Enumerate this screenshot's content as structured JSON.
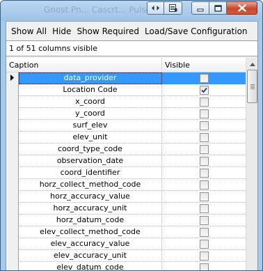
{
  "window": {
    "ghost_title": "Gnost Pn... Cascrt... Pulse"
  },
  "menubar": {
    "items": [
      "Show All",
      "Hide",
      "Show Required",
      "Load/Save Configuration"
    ]
  },
  "status": {
    "text": "1 of 51 columns visible"
  },
  "grid": {
    "headers": {
      "caption": "Caption",
      "visible": "Visible"
    },
    "rows": [
      {
        "caption": "data_provider",
        "visible": false,
        "selected": true,
        "current": true
      },
      {
        "caption": "Location Code",
        "visible": true
      },
      {
        "caption": "x_coord",
        "visible": false
      },
      {
        "caption": "y_coord",
        "visible": false
      },
      {
        "caption": "surf_elev",
        "visible": false
      },
      {
        "caption": "elev_unit",
        "visible": false
      },
      {
        "caption": "coord_type_code",
        "visible": false
      },
      {
        "caption": "observation_date",
        "visible": false
      },
      {
        "caption": "coord_identifier",
        "visible": false
      },
      {
        "caption": "horz_collect_method_code",
        "visible": false
      },
      {
        "caption": "horz_accuracy_value",
        "visible": false
      },
      {
        "caption": "horz_accuracy_unit",
        "visible": false
      },
      {
        "caption": "horz_datum_code",
        "visible": false
      },
      {
        "caption": "elev_collect_method_code",
        "visible": false
      },
      {
        "caption": "elev_accuracy_value",
        "visible": false
      },
      {
        "caption": "elev_accuracy_unit",
        "visible": false
      },
      {
        "caption": "elev_datum_code",
        "visible": false
      }
    ]
  },
  "colors": {
    "selection": "#3399ff",
    "titlebar": "#a7c9e9",
    "close_button": "#c9462a"
  },
  "icons": [
    "resize-icon",
    "system-menu-icon",
    "minimize-icon",
    "maximize-icon",
    "close-icon",
    "current-row-arrow-icon",
    "checkmark-icon",
    "scroll-up-icon"
  ]
}
